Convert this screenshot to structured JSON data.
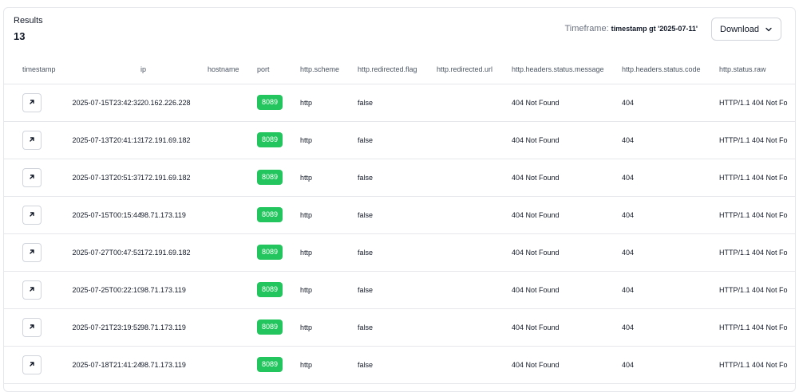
{
  "results": {
    "label": "Results",
    "count": "13"
  },
  "timeframe": {
    "label": "Timeframe:",
    "value": "timestamp gt '2025-07-11'"
  },
  "download": {
    "label": "Download",
    "icon": "chevron-down-icon"
  },
  "table": {
    "headers": [
      "timestamp",
      "ip",
      "hostname",
      "port",
      "http.scheme",
      "http.redirected.flag",
      "http.redirected.url",
      "http.headers.status.message",
      "http.headers.status.code",
      "http.status.raw"
    ],
    "rows": [
      {
        "timestamp": "2025-07-15T23:42:32",
        "ip": "20.162.226.228",
        "hostname": "",
        "port": "8089",
        "scheme": "http",
        "flag": "false",
        "url": "",
        "message": "404 Not Found",
        "code": "404",
        "raw": "HTTP/1.1 404 Not Fo"
      },
      {
        "timestamp": "2025-07-13T20:41:13",
        "ip": "172.191.69.182",
        "hostname": "",
        "port": "8089",
        "scheme": "http",
        "flag": "false",
        "url": "",
        "message": "404 Not Found",
        "code": "404",
        "raw": "HTTP/1.1 404 Not Fo"
      },
      {
        "timestamp": "2025-07-13T20:51:37",
        "ip": "172.191.69.182",
        "hostname": "",
        "port": "8089",
        "scheme": "http",
        "flag": "false",
        "url": "",
        "message": "404 Not Found",
        "code": "404",
        "raw": "HTTP/1.1 404 Not Fo"
      },
      {
        "timestamp": "2025-07-15T00:15:44",
        "ip": "98.71.173.119",
        "hostname": "",
        "port": "8089",
        "scheme": "http",
        "flag": "false",
        "url": "",
        "message": "404 Not Found",
        "code": "404",
        "raw": "HTTP/1.1 404 Not Fo"
      },
      {
        "timestamp": "2025-07-27T00:47:53",
        "ip": "172.191.69.182",
        "hostname": "",
        "port": "8089",
        "scheme": "http",
        "flag": "false",
        "url": "",
        "message": "404 Not Found",
        "code": "404",
        "raw": "HTTP/1.1 404 Not Fo"
      },
      {
        "timestamp": "2025-07-25T00:22:10",
        "ip": "98.71.173.119",
        "hostname": "",
        "port": "8089",
        "scheme": "http",
        "flag": "false",
        "url": "",
        "message": "404 Not Found",
        "code": "404",
        "raw": "HTTP/1.1 404 Not Fo"
      },
      {
        "timestamp": "2025-07-21T23:19:52",
        "ip": "98.71.173.119",
        "hostname": "",
        "port": "8089",
        "scheme": "http",
        "flag": "false",
        "url": "",
        "message": "404 Not Found",
        "code": "404",
        "raw": "HTTP/1.1 404 Not Fo"
      },
      {
        "timestamp": "2025-07-18T21:41:24",
        "ip": "98.71.173.119",
        "hostname": "",
        "port": "8089",
        "scheme": "http",
        "flag": "false",
        "url": "",
        "message": "404 Not Found",
        "code": "404",
        "raw": "HTTP/1.1 404 Not Fo"
      }
    ]
  },
  "icons": {
    "row_open": "arrow-up-right-icon"
  },
  "colors": {
    "port_badge": "#22c55e",
    "border": "#e5e7eb",
    "text": "#111827",
    "muted": "#6b7280"
  }
}
